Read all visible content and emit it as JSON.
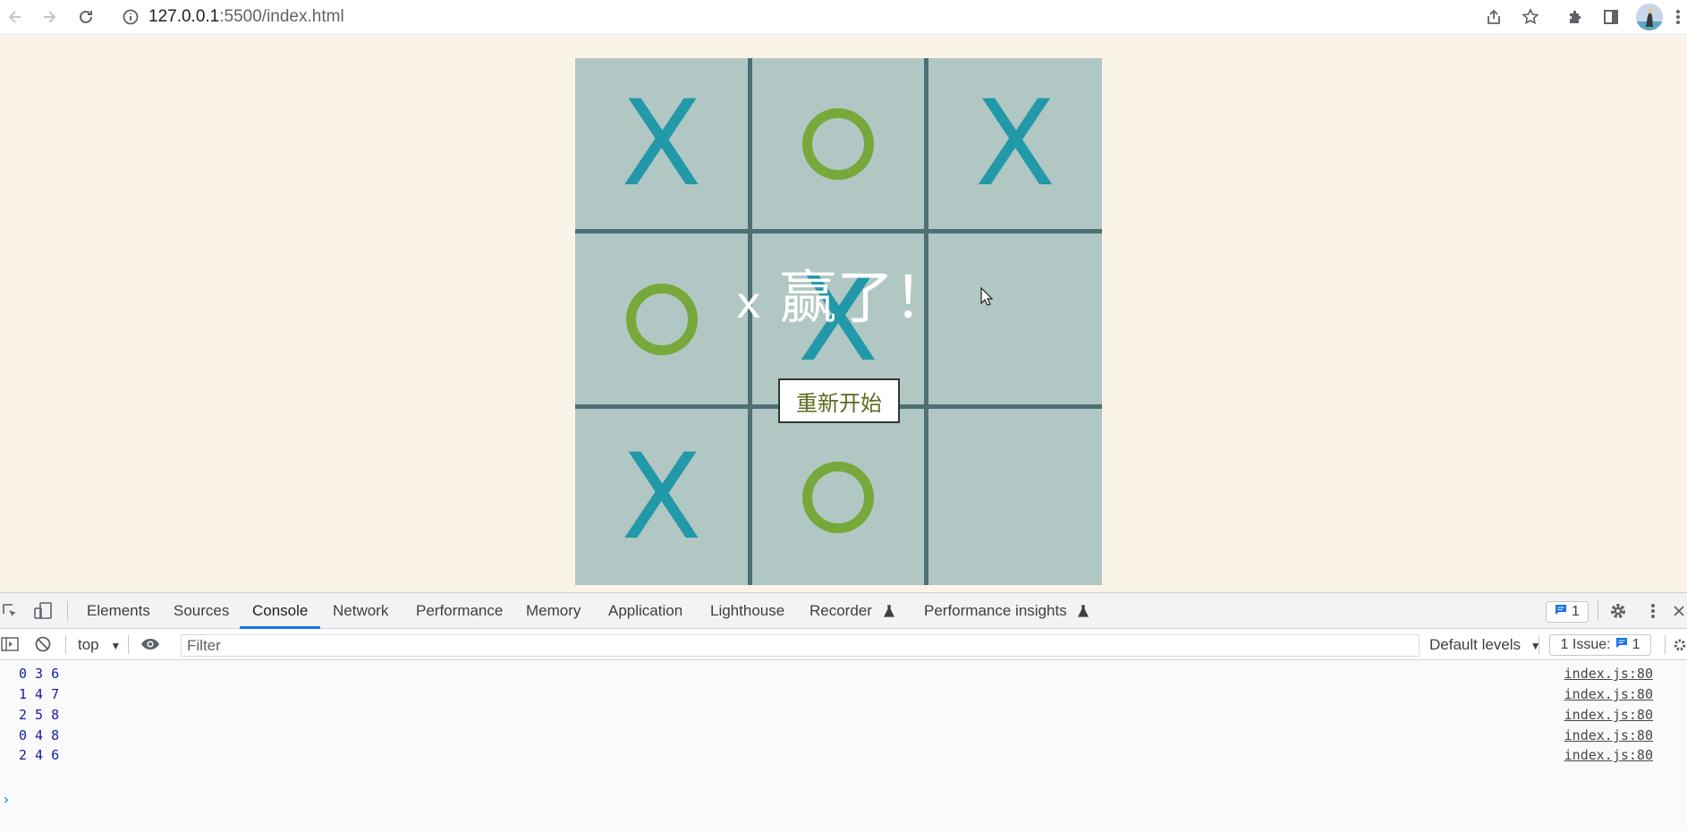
{
  "browser": {
    "url_host": "127.0.0.1",
    "url_rest": ":5500/index.html"
  },
  "game": {
    "board": [
      "X",
      "O",
      "X",
      "O",
      "X",
      "",
      "X",
      "O",
      ""
    ],
    "result_symbol": "x",
    "result_text": "赢了！",
    "restart_label": "重新开始",
    "colors": {
      "x": "#2199a9",
      "o": "#77a83a",
      "cell": "#b1c7c3",
      "grid": "#4e7074",
      "page": "#faf4e8"
    }
  },
  "devtools": {
    "tabs": [
      "Elements",
      "Sources",
      "Console",
      "Network",
      "Performance",
      "Memory",
      "Application",
      "Lighthouse",
      "Recorder",
      "Performance insights"
    ],
    "active_tab": "Console",
    "message_count": "1",
    "context": "top",
    "filter_placeholder": "Filter",
    "levels_label": "Default levels",
    "issues_label": "1 Issue:",
    "issues_count": "1",
    "logs": [
      {
        "msg": "0 3 6",
        "src": "index.js:80"
      },
      {
        "msg": "1 4 7",
        "src": "index.js:80"
      },
      {
        "msg": "2 5 8",
        "src": "index.js:80"
      },
      {
        "msg": "0 4 8",
        "src": "index.js:80"
      },
      {
        "msg": "2 4 6",
        "src": "index.js:80"
      }
    ]
  }
}
